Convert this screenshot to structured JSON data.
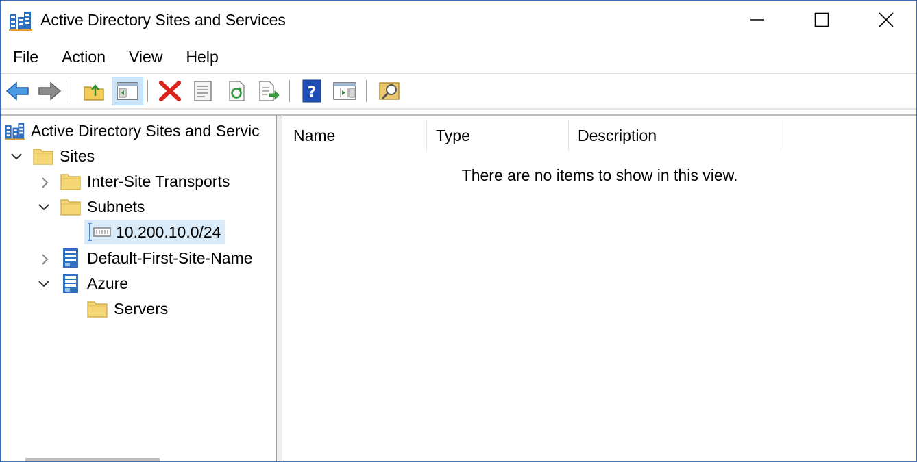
{
  "window": {
    "title": "Active Directory Sites and Services"
  },
  "menu": [
    "File",
    "Action",
    "View",
    "Help"
  ],
  "toolbar": {
    "buttons": [
      {
        "icon": "back-arrow-icon"
      },
      {
        "icon": "forward-arrow-icon"
      },
      {
        "icon": "up-folder-icon"
      },
      {
        "icon": "show-hide-console-tree-icon",
        "pressed": true
      },
      {
        "icon": "delete-icon"
      },
      {
        "icon": "properties-icon"
      },
      {
        "icon": "refresh-icon"
      },
      {
        "icon": "export-list-icon"
      },
      {
        "icon": "help-icon"
      },
      {
        "icon": "show-action-pane-icon"
      },
      {
        "icon": "find-icon"
      }
    ]
  },
  "tree": {
    "root": "Active Directory Sites and Servic",
    "sites": "Sites",
    "inter_site": "Inter-Site Transports",
    "subnets": "Subnets",
    "subnet_item": "10.200.10.0/24",
    "default_site": "Default-First-Site-Name",
    "azure": "Azure",
    "servers": "Servers"
  },
  "list": {
    "columns": [
      "Name",
      "Type",
      "Description"
    ],
    "empty_message": "There are no items to show in this view."
  },
  "colors": {
    "selection": "#d9ebf9",
    "accent": "#3c6fc4",
    "folder": "#f5d777"
  }
}
